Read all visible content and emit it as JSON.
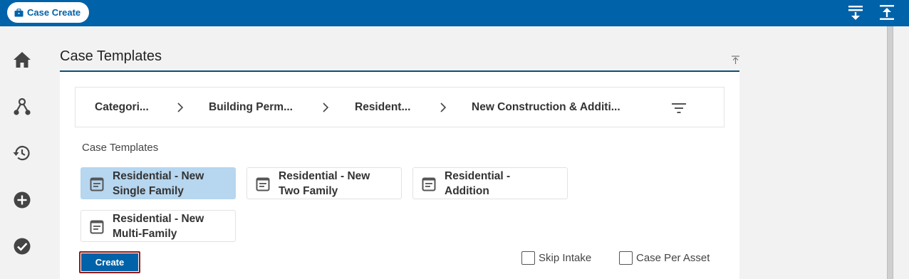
{
  "header": {
    "app_button_label": "Case Create",
    "icons": [
      "briefcase-icon",
      "expand-all-icon",
      "collapse-all-icon"
    ]
  },
  "sidebar": {
    "items": [
      {
        "icon": "home-icon"
      },
      {
        "icon": "workflow-icon"
      },
      {
        "icon": "history-icon"
      },
      {
        "icon": "add-circle-icon"
      },
      {
        "icon": "check-circle-icon"
      }
    ]
  },
  "section": {
    "title": "Case Templates"
  },
  "breadcrumb": {
    "items": [
      "Categori...",
      "Building Perm...",
      "Resident...",
      "New Construction & Additi..."
    ]
  },
  "templates": {
    "label": "Case Templates",
    "items": [
      {
        "line1": "Residential - New",
        "line2": "Single Family",
        "selected": true
      },
      {
        "line1": "Residential - New",
        "line2": "Two Family",
        "selected": false
      },
      {
        "line1": "Residential -",
        "line2": "Addition",
        "selected": false
      },
      {
        "line1": "Residential - New",
        "line2": "Multi-Family",
        "selected": false
      }
    ]
  },
  "actions": {
    "create_label": "Create",
    "skip_intake_label": "Skip Intake",
    "skip_intake_checked": false,
    "case_per_asset_label": "Case Per Asset",
    "case_per_asset_checked": false
  },
  "colors": {
    "brand": "#0062a8",
    "selected": "#b7d6ef",
    "focus_outline": "#8b1c1c"
  }
}
